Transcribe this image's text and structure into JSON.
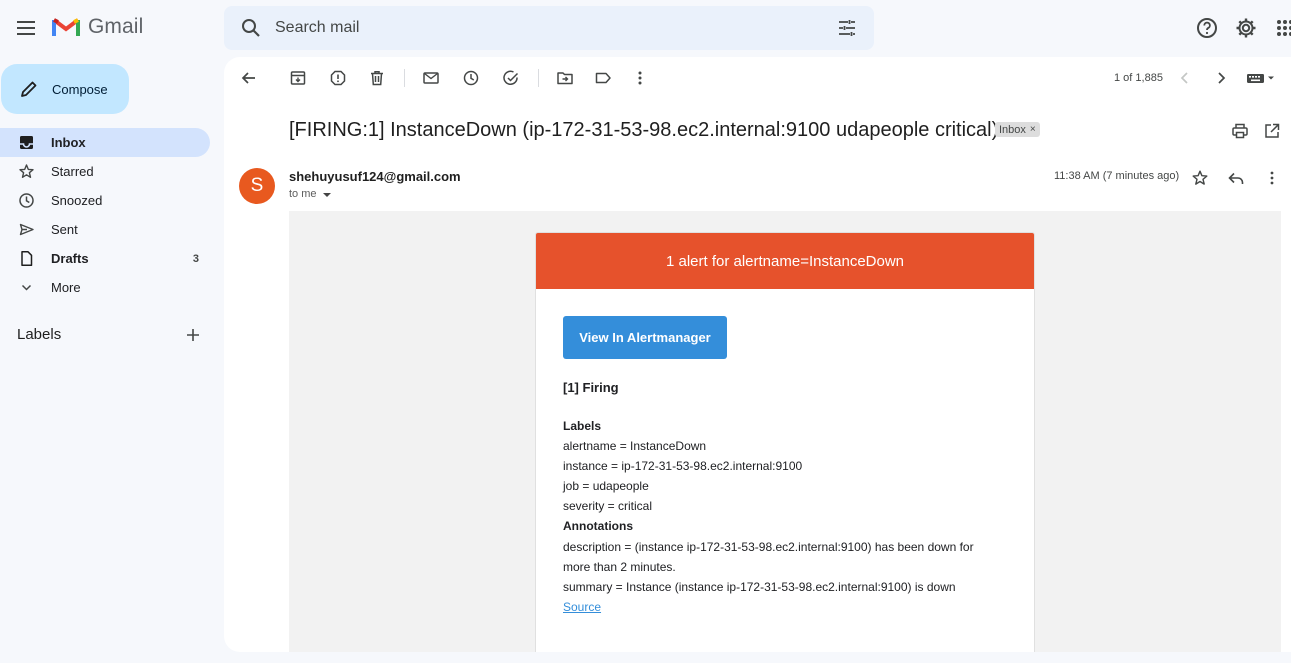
{
  "app": {
    "name": "Gmail",
    "colors": {
      "compose_bg": "#c2e7ff",
      "active_nav_bg": "#d3e3fd",
      "alert_header": "#e6522c",
      "button_blue": "#348eda",
      "avatar": "#e8591f"
    }
  },
  "search": {
    "placeholder": "Search mail"
  },
  "sidebar": {
    "compose_label": "Compose",
    "items": [
      {
        "label": "Inbox",
        "icon": "inbox-icon",
        "count": ""
      },
      {
        "label": "Starred",
        "icon": "star-icon",
        "count": ""
      },
      {
        "label": "Snoozed",
        "icon": "clock-icon",
        "count": ""
      },
      {
        "label": "Sent",
        "icon": "send-icon",
        "count": ""
      },
      {
        "label": "Drafts",
        "icon": "draft-icon",
        "count": "3"
      },
      {
        "label": "More",
        "icon": "chevron-down-icon",
        "count": ""
      }
    ],
    "labels_title": "Labels"
  },
  "toolbar": {
    "pager": "1 of 1,885"
  },
  "message": {
    "subject": "[FIRING:1] InstanceDown (ip-172-31-53-98.ec2.internal:9100 udapeople critical)",
    "chip": "Inbox",
    "chip_close": "×",
    "avatar_letter": "S",
    "sender": "shehuyusuf124@gmail.com",
    "to": "to me",
    "time": "11:38 AM (7 minutes ago)"
  },
  "email": {
    "header": "1 alert for alertname=InstanceDown",
    "button": "View In Alertmanager",
    "firing": "[1] Firing",
    "labels_title": "Labels",
    "labels": [
      "alertname = InstanceDown",
      "instance = ip-172-31-53-98.ec2.internal:9100",
      "job = udapeople",
      "severity = critical"
    ],
    "annotations_title": "Annotations",
    "description_line1": "description = (instance ip-172-31-53-98.ec2.internal:9100) has been down for",
    "description_line2": "more than 2 minutes.",
    "summary": "summary = Instance (instance ip-172-31-53-98.ec2.internal:9100) is down",
    "source": "Source"
  }
}
